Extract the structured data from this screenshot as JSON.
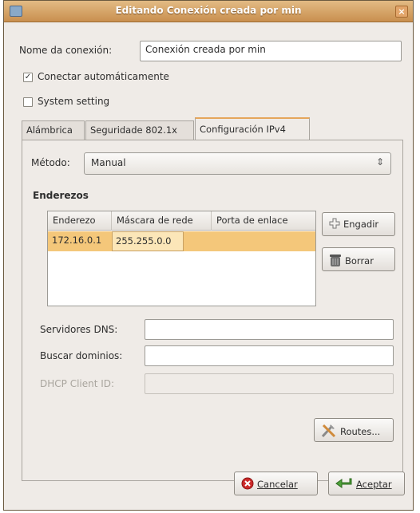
{
  "window": {
    "title": "Editando Conexión creada por min",
    "close_glyph": "×"
  },
  "connection_name": {
    "label": "Nome da conexión:",
    "value": "Conexión creada por min"
  },
  "auto_connect": {
    "label": "Conectar automáticamente",
    "checked": true
  },
  "system_setting": {
    "label": "System setting",
    "checked": false
  },
  "tabs": [
    {
      "label": "Alámbrica"
    },
    {
      "label": "Seguridade 802.1x"
    },
    {
      "label": "Configuración IPv4"
    }
  ],
  "method": {
    "label": "Método:",
    "value": "Manual"
  },
  "addresses": {
    "heading": "Enderezos",
    "columns": [
      "Enderezo",
      "Máscara de rede",
      "Porta de enlace"
    ],
    "rows": [
      {
        "address": "172.16.0.1",
        "netmask": "255.255.0.0",
        "gateway": ""
      }
    ],
    "add_label": "Engadir",
    "delete_label": "Borrar"
  },
  "dns": {
    "label": "Servidores DNS:",
    "value": ""
  },
  "search_domains": {
    "label": "Buscar dominios:",
    "value": ""
  },
  "dhcp_client_id": {
    "label": "DHCP Client ID:",
    "value": ""
  },
  "routes_label": "Routes...",
  "cancel_label": "Cancelar",
  "ok_label": "Aceptar",
  "icons": {
    "add": "plus-icon",
    "delete": "trash-icon",
    "routes": "tools-icon",
    "cancel": "cancel-icon",
    "ok": "ok-arrow-icon"
  }
}
